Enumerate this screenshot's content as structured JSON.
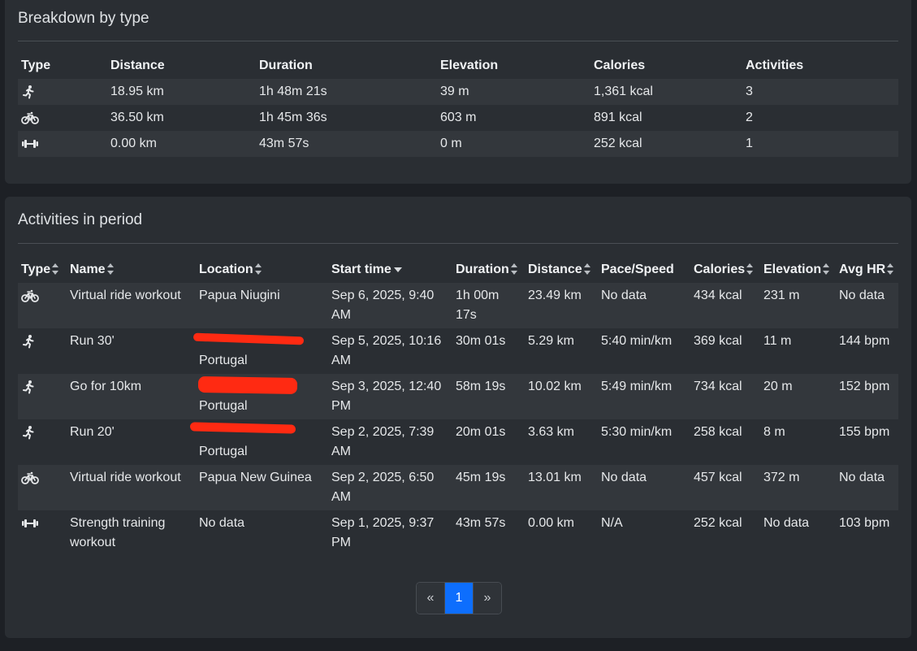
{
  "breakdown": {
    "title": "Breakdown by type",
    "headers": [
      "Type",
      "Distance",
      "Duration",
      "Elevation",
      "Calories",
      "Activities"
    ],
    "rows": [
      {
        "icon": "running-icon",
        "distance": "18.95 km",
        "duration": "1h 48m 21s",
        "elevation": "39 m",
        "calories": "1,361 kcal",
        "activities": "3"
      },
      {
        "icon": "bicycle-icon",
        "distance": "36.50 km",
        "duration": "1h 45m 36s",
        "elevation": "603 m",
        "calories": "891 kcal",
        "activities": "2"
      },
      {
        "icon": "dumbbell-icon",
        "distance": "0.00 km",
        "duration": "43m 57s",
        "elevation": "0 m",
        "calories": "252 kcal",
        "activities": "1"
      }
    ]
  },
  "activities": {
    "title": "Activities in period",
    "headers": [
      "Type",
      "Name",
      "Location",
      "Start time",
      "Duration",
      "Distance",
      "Pace/Speed",
      "Calories",
      "Elevation",
      "Avg HR"
    ],
    "rows": [
      {
        "icon": "bicycle-icon",
        "name": "Virtual ride workout",
        "location": "Papua Niugini",
        "start": "Sep 6, 2025, 9:40 AM",
        "duration": "1h 00m 17s",
        "distance": "23.49 km",
        "pace": "No data",
        "calories": "434 kcal",
        "elevation": "231 m",
        "hr": "No data"
      },
      {
        "icon": "running-icon",
        "name": "Run 30'",
        "location": "Portugal",
        "start": "Sep 5, 2025, 10:16 AM",
        "duration": "30m 01s",
        "distance": "5.29 km",
        "pace": "5:40 min/km",
        "calories": "369 kcal",
        "elevation": "11 m",
        "hr": "144 bpm"
      },
      {
        "icon": "running-icon",
        "name": "Go for 10km",
        "location": "Portugal",
        "start": "Sep 3, 2025, 12:40 PM",
        "duration": "58m 19s",
        "distance": "10.02 km",
        "pace": "5:49 min/km",
        "calories": "734 kcal",
        "elevation": "20 m",
        "hr": "152 bpm"
      },
      {
        "icon": "running-icon",
        "name": "Run 20'",
        "location": "Portugal",
        "start": "Sep 2, 2025, 7:39 AM",
        "duration": "20m 01s",
        "distance": "3.63 km",
        "pace": "5:30 min/km",
        "calories": "258 kcal",
        "elevation": "8 m",
        "hr": "155 bpm"
      },
      {
        "icon": "bicycle-icon",
        "name": "Virtual ride workout",
        "location": "Papua New Guinea",
        "start": "Sep 2, 2025, 6:50 AM",
        "duration": "45m 19s",
        "distance": "13.01 km",
        "pace": "No data",
        "calories": "457 kcal",
        "elevation": "372 m",
        "hr": "No data"
      },
      {
        "icon": "dumbbell-icon",
        "name": "Strength training workout",
        "location": "No data",
        "start": "Sep 1, 2025, 9:37 PM",
        "duration": "43m 57s",
        "distance": "0.00 km",
        "pace": "N/A",
        "calories": "252 kcal",
        "elevation": "No data",
        "hr": "103 bpm"
      }
    ]
  },
  "pagination": {
    "prev": "«",
    "page": "1",
    "next": "»"
  },
  "colors": {
    "accent": "#0d6efd",
    "redaction": "#ff2a12"
  }
}
